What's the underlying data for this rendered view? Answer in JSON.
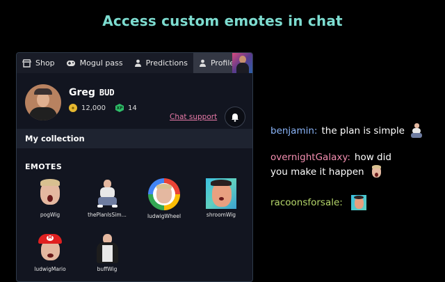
{
  "headline": "Access custom emotes in chat",
  "tabs": [
    {
      "label": "Shop",
      "icon": "store-icon"
    },
    {
      "label": "Mogul pass",
      "icon": "gamepad-icon"
    },
    {
      "label": "Predictions",
      "icon": "person-icon"
    },
    {
      "label": "Profile",
      "icon": "person-icon"
    }
  ],
  "profile": {
    "name": "Greg",
    "tag": "BUD",
    "coins": "12,000",
    "xp": "14",
    "xp_badge": "XP",
    "support_link": "Chat support"
  },
  "collection_title": "My collection",
  "emotes_title": "EMOTES",
  "emotes": [
    {
      "label": "pogWig"
    },
    {
      "label": "thePlanIsSim..."
    },
    {
      "label": "ludwigWheel"
    },
    {
      "label": "shroomWig"
    },
    {
      "label": "ludwigMario"
    },
    {
      "label": "buffWig"
    }
  ],
  "chat": [
    {
      "user": "benjamin:",
      "message": "the plan is simple",
      "color": "#8ab4f8"
    },
    {
      "user": "overnightGalaxy:",
      "message": "how did you make it happen",
      "color": "#f48fb1"
    },
    {
      "user": "racoonsforsale:",
      "message": "",
      "color": "#b5d66a"
    }
  ],
  "colors": {
    "headline": "#7ddcd0",
    "support_link": "#e87aa8",
    "panel": "#121520"
  }
}
